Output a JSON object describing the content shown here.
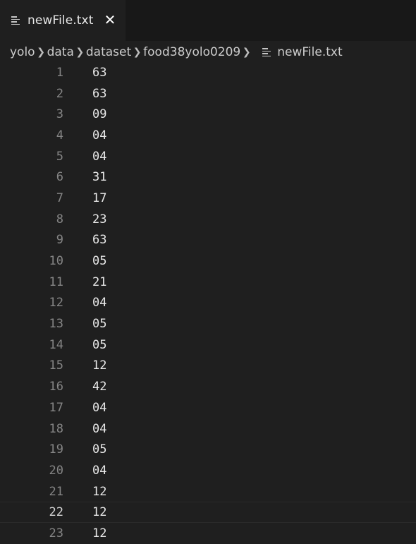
{
  "tab": {
    "label": "newFile.txt",
    "close": "✕"
  },
  "breadcrumb": {
    "items": [
      "yolo",
      "data",
      "dataset",
      "food38yolo0209"
    ],
    "file": "newFile.txt"
  },
  "editor": {
    "current_line": 22,
    "lines": [
      {
        "n": "1",
        "text": "63"
      },
      {
        "n": "2",
        "text": "63"
      },
      {
        "n": "3",
        "text": "09"
      },
      {
        "n": "4",
        "text": "04"
      },
      {
        "n": "5",
        "text": "04"
      },
      {
        "n": "6",
        "text": "31"
      },
      {
        "n": "7",
        "text": "17"
      },
      {
        "n": "8",
        "text": "23"
      },
      {
        "n": "9",
        "text": "63"
      },
      {
        "n": "10",
        "text": "05"
      },
      {
        "n": "11",
        "text": "21"
      },
      {
        "n": "12",
        "text": "04"
      },
      {
        "n": "13",
        "text": "05"
      },
      {
        "n": "14",
        "text": "05"
      },
      {
        "n": "15",
        "text": "12"
      },
      {
        "n": "16",
        "text": "42"
      },
      {
        "n": "17",
        "text": "04"
      },
      {
        "n": "18",
        "text": "04"
      },
      {
        "n": "19",
        "text": "05"
      },
      {
        "n": "20",
        "text": "04"
      },
      {
        "n": "21",
        "text": "12"
      },
      {
        "n": "22",
        "text": "12"
      },
      {
        "n": "23",
        "text": "12"
      }
    ]
  }
}
